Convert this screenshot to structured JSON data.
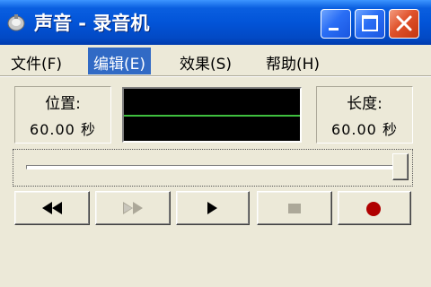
{
  "window": {
    "title": "声音 - 录音机",
    "icon": "microphone-icon",
    "controls": [
      "minimize-icon",
      "maximize-icon",
      "close-icon"
    ]
  },
  "menu": {
    "file": "文件(F)",
    "edit": "编辑(E)",
    "effects": "效果(S)",
    "help": "帮助(H)",
    "active": "edit"
  },
  "position": {
    "label": "位置:",
    "value": "60.00 秒"
  },
  "length": {
    "label": "长度:",
    "value": "60.00 秒"
  },
  "waveform": {
    "background": "#000000",
    "line_color": "#3fbf3f"
  },
  "slider": {
    "position_fraction": 1.0
  },
  "transport": {
    "rewind": {
      "icon": "seek-start-icon",
      "enabled": true
    },
    "fast_forward": {
      "icon": "seek-end-icon",
      "enabled": false
    },
    "play": {
      "icon": "play-icon",
      "enabled": true
    },
    "stop": {
      "icon": "stop-icon",
      "enabled": false
    },
    "record": {
      "icon": "record-icon",
      "enabled": true,
      "color": "#b00000"
    }
  },
  "colors": {
    "titlebar": "#0254d8",
    "menu_highlight": "#316ac5",
    "face": "#ece9d8"
  }
}
